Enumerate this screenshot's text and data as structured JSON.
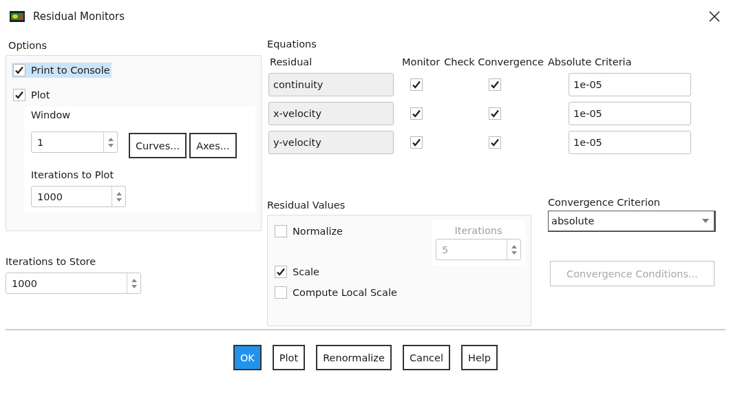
{
  "window": {
    "title": "Residual Monitors"
  },
  "options": {
    "label": "Options",
    "checkboxes": [
      {
        "label": "Print to Console",
        "checked": true,
        "highlighted": true
      },
      {
        "label": "Plot",
        "checked": true,
        "highlighted": false
      }
    ],
    "window_field": {
      "label": "Window",
      "value": "1"
    },
    "buttons": [
      "Curves...",
      "Axes..."
    ],
    "iterations_to_plot": {
      "label": "Iterations to Plot",
      "value": "1000"
    }
  },
  "iterations_to_store": {
    "label": "Iterations to Store",
    "value": "1000"
  },
  "equations": {
    "label": "Equations",
    "columns": [
      "Residual",
      "Monitor",
      "Check Convergence",
      "Absolute Criteria"
    ],
    "rows": [
      {
        "residual": "continuity",
        "monitor": true,
        "check_convergence": true,
        "criteria": "1e-05"
      },
      {
        "residual": "x-velocity",
        "monitor": true,
        "check_convergence": true,
        "criteria": "1e-05"
      },
      {
        "residual": "y-velocity",
        "monitor": true,
        "check_convergence": true,
        "criteria": "1e-05"
      }
    ]
  },
  "residual_values": {
    "label": "Residual Values",
    "normalize": {
      "label": "Normalize",
      "checked": false
    },
    "iterations": {
      "label": "Iterations",
      "value": "5",
      "disabled": true
    },
    "checkboxes": [
      {
        "label": "Scale",
        "checked": true
      },
      {
        "label": "Compute Local Scale",
        "checked": false
      }
    ]
  },
  "convergence_criterion": {
    "label": "Convergence Criterion",
    "value": "absolute"
  },
  "convergence_conditions": {
    "label": "Convergence Conditions...",
    "disabled": true
  },
  "buttons": [
    {
      "label": "OK",
      "primary": true
    },
    {
      "label": "Plot",
      "primary": false
    },
    {
      "label": "Renormalize",
      "primary": false
    },
    {
      "label": "Cancel",
      "primary": false
    },
    {
      "label": "Help",
      "primary": false
    }
  ]
}
